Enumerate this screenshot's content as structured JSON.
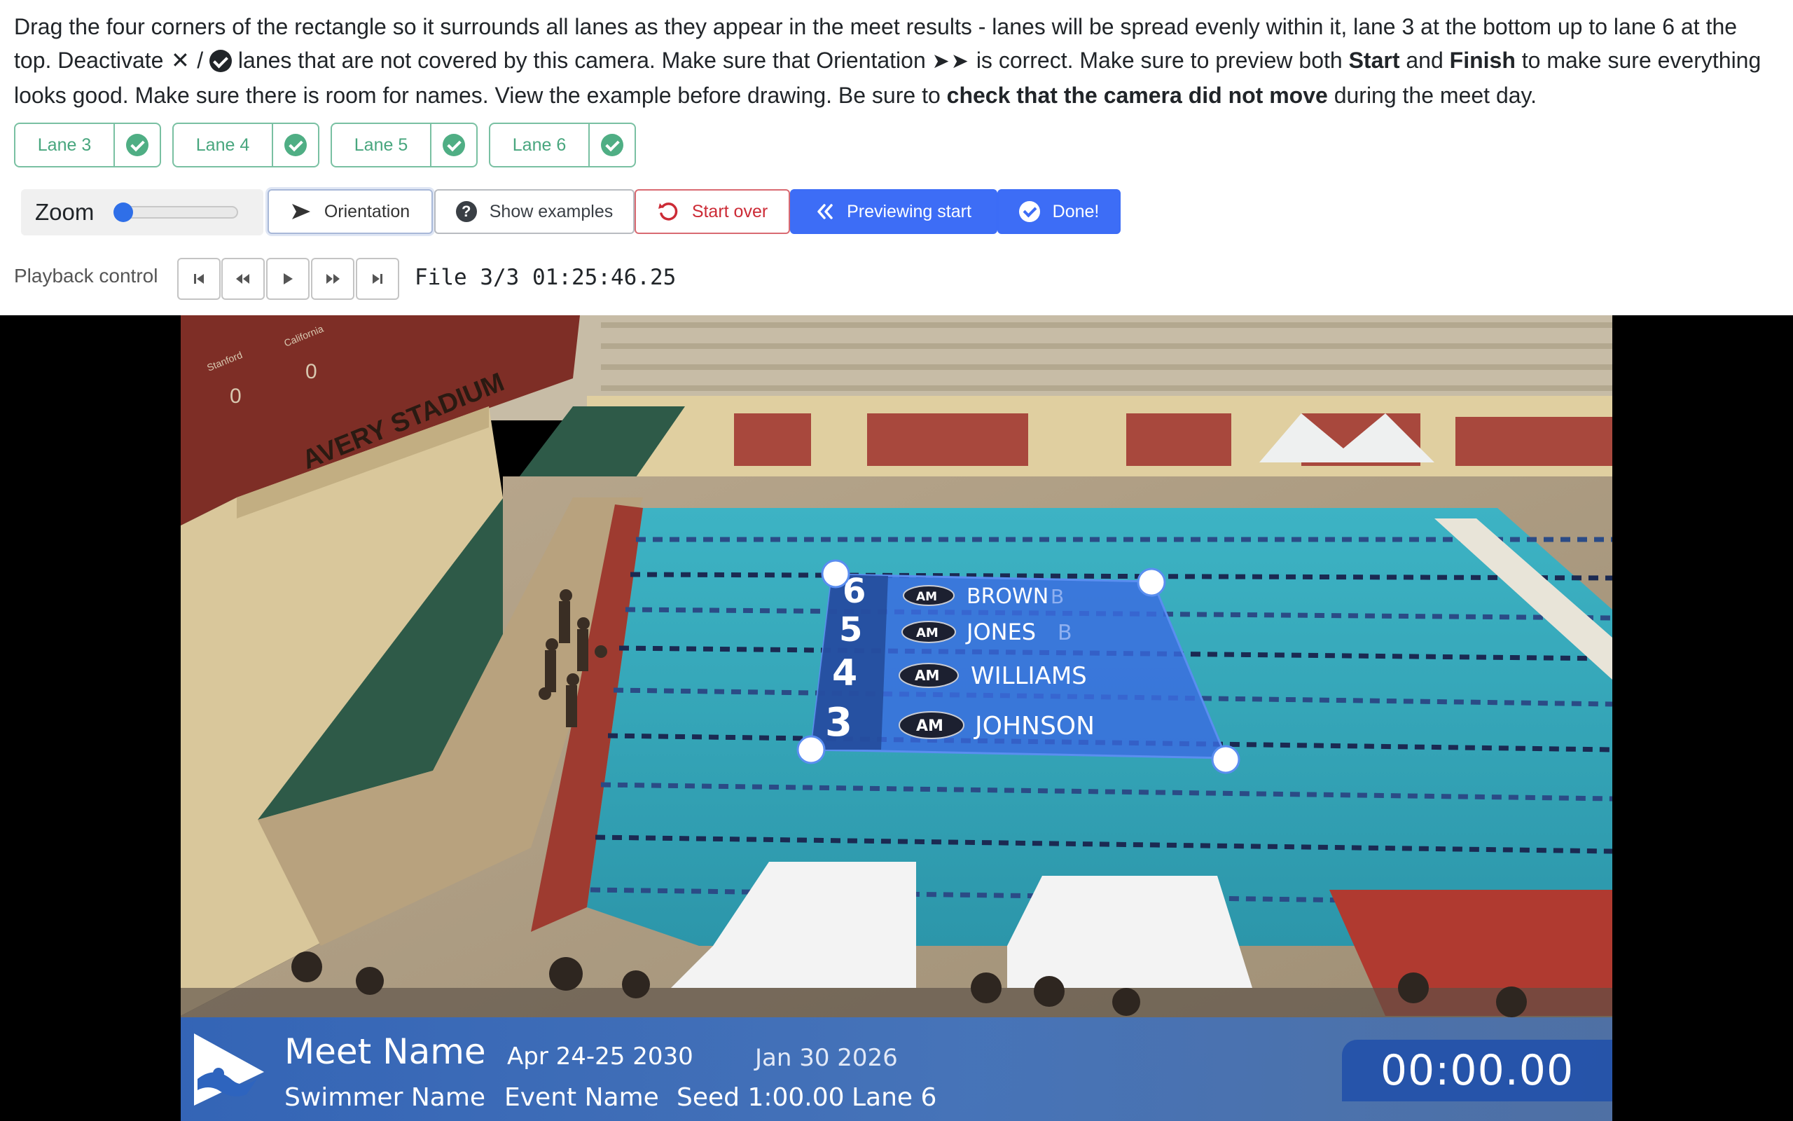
{
  "instructions": {
    "p1": "Drag the four corners of the rectangle so it surrounds all lanes as they appear in the meet results - lanes will be spread evenly within it, lane 3 at the bottom up to lane 6 at the top. Deactivate",
    "x_glyph": "✕",
    "slash": "/",
    "p2": "lanes that are not covered by this camera. Make sure that Orientation",
    "arrows": "➤➤",
    "p3": "is correct. Make sure to preview both",
    "start_word": "Start",
    "and_word": "and",
    "finish_word": "Finish",
    "p4": "to make sure everything looks good. Make sure there is room for names. View the example before drawing. Be sure to",
    "bold_check": "check that the camera did not move",
    "p5": "during the meet day."
  },
  "lanes": [
    {
      "label": "Lane 3",
      "active": true
    },
    {
      "label": "Lane 4",
      "active": true
    },
    {
      "label": "Lane 5",
      "active": true
    },
    {
      "label": "Lane 6",
      "active": true
    }
  ],
  "toolbar": {
    "zoom_label": "Zoom",
    "zoom_value": 0,
    "orientation_label": "Orientation",
    "examples_label": "Show examples",
    "startover_label": "Start over",
    "preview_label": "Previewing start",
    "done_label": "Done!"
  },
  "playback": {
    "label": "Playback control",
    "file_status": "File 3/3 01:25:46.25"
  },
  "overlay": {
    "rows": [
      {
        "lane": "6",
        "name": "BROWN",
        "ghost": "B"
      },
      {
        "lane": "5",
        "name": "JONES",
        "ghost": "B"
      },
      {
        "lane": "4",
        "name": "WILLIAMS",
        "ghost": ""
      },
      {
        "lane": "3",
        "name": "JOHNSON",
        "ghost": ""
      }
    ],
    "badge_text": "AM"
  },
  "scene_text": {
    "stadium_sign": "AVERY STADIUM",
    "scoreboard_left": "Stanford",
    "scoreboard_left_score": "0",
    "scoreboard_right": "California",
    "scoreboard_right_score": "0"
  },
  "lower_third": {
    "meet_name": "Meet Name",
    "dates": "Apr 24-25 2030",
    "today": "Jan 30 2026",
    "swimmer_name": "Swimmer Name",
    "event_name": "Event Name",
    "seed": "Seed 1:00.00",
    "lane": "Lane 6",
    "timer": "00:00.00"
  },
  "colors": {
    "accent_blue": "#3d6df6",
    "lane_green": "#4fae84",
    "danger_red": "#cc2b36",
    "pool_water": "#2d9bb0"
  }
}
